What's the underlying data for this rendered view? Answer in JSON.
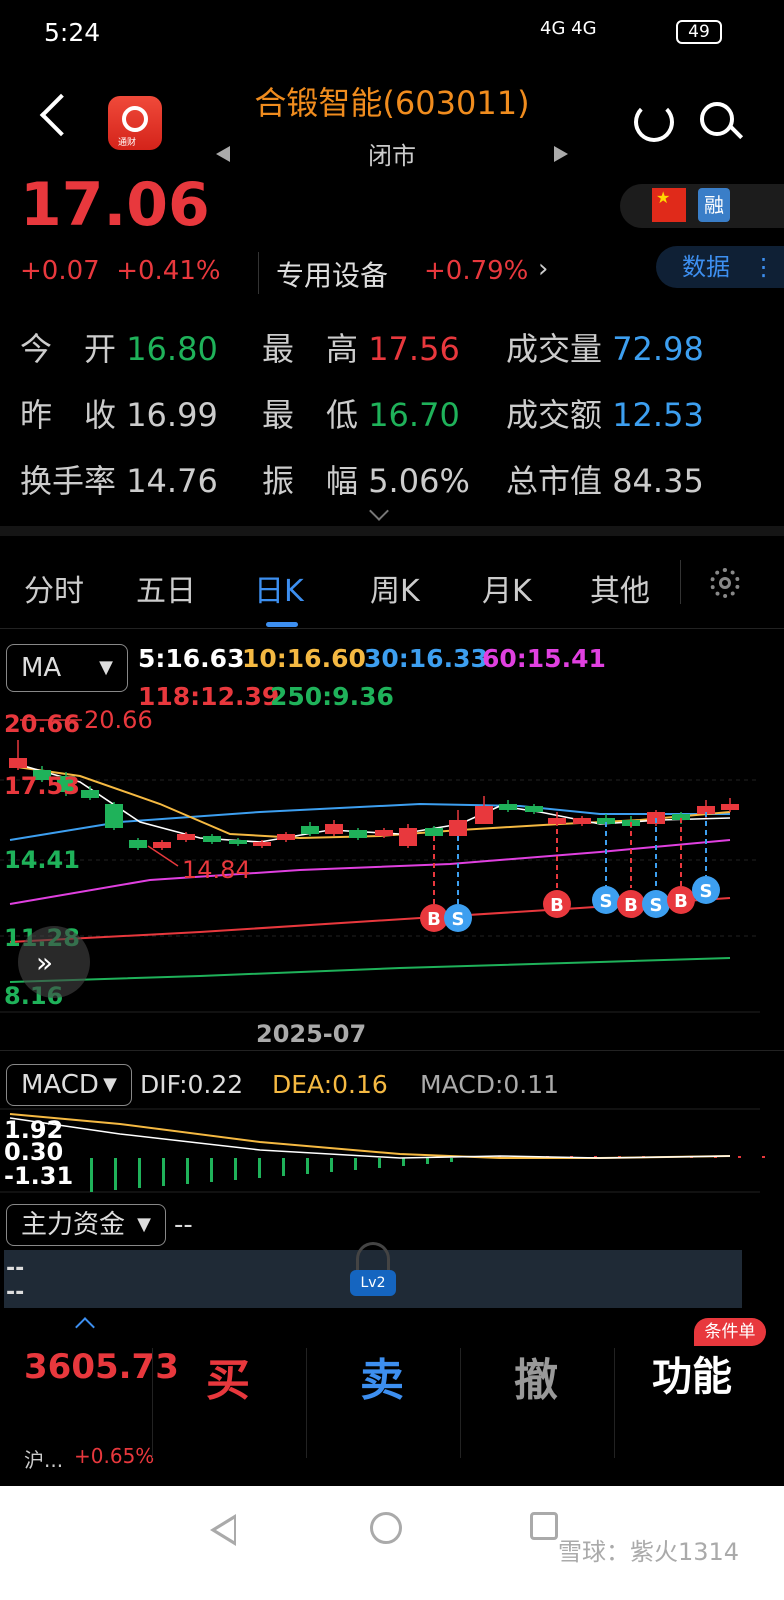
{
  "status_bar": {
    "time": "5:24",
    "network": "4G 4G",
    "battery": "49"
  },
  "header": {
    "title": "合锻智能(603011)",
    "market_status": "闭市",
    "app_icon_text": "通财"
  },
  "quote": {
    "price": "17.06",
    "change": "+0.07",
    "change_pct": "+0.41%",
    "industry": "专用设备",
    "industry_change": "+0.79%",
    "flags": {
      "rong": "融"
    },
    "data_button": "数据",
    "rows": [
      [
        {
          "label": "今　开",
          "value": "16.80"
        },
        {
          "label": "最　高",
          "value": "17.56"
        },
        {
          "label": "成交量",
          "value": "72.98"
        }
      ],
      [
        {
          "label": "昨　收",
          "value": "16.99"
        },
        {
          "label": "最　低",
          "value": "16.70"
        },
        {
          "label": "成交额",
          "value": "12.53"
        }
      ],
      [
        {
          "label": "换手率",
          "value": "14.76"
        },
        {
          "label": "振　幅",
          "value": "5.06%"
        },
        {
          "label": "总市值",
          "value": "84.35"
        }
      ]
    ],
    "colors": {
      "up": "#e8383d",
      "down": "#1fb25a",
      "volume": "#3d9ff0"
    }
  },
  "tabs": [
    "分时",
    "五日",
    "日K",
    "周K",
    "月K",
    "其他"
  ],
  "active_tab": "日K",
  "kline": {
    "indicator": "MA",
    "ma": [
      {
        "label": "5:16.63",
        "color": "#ffffff"
      },
      {
        "label": "10:16.60",
        "color": "#f5b942"
      },
      {
        "label": "30:16.33",
        "color": "#3d9ff0"
      },
      {
        "label": "60:15.41",
        "color": "#e040e0"
      },
      {
        "label": "118:12.39",
        "color": "#e8383d"
      },
      {
        "label": "250:9.36",
        "color": "#1fb25a"
      }
    ],
    "y_labels": [
      "20.66",
      "17.53",
      "14.41",
      "11.28",
      "8.16"
    ],
    "high_marker": "20.66",
    "low_marker": "14.84",
    "date_label": "2025-07",
    "signals": [
      "B",
      "S",
      "B",
      "S",
      "B",
      "S",
      "B",
      "S"
    ]
  },
  "macd": {
    "indicator": "MACD",
    "dif": "DIF:0.22",
    "dea": "DEA:0.16",
    "macd": "MACD:0.11",
    "y_labels": [
      "1.92",
      "0.30",
      "-1.31"
    ]
  },
  "main_force": {
    "indicator": "主力资金",
    "value": "--",
    "rows": [
      "--",
      "--"
    ],
    "lv2": "Lv2"
  },
  "bottom": {
    "index_value": "3605.73",
    "index_name": "沪...",
    "index_change": "+0.65%",
    "buy": "买",
    "sell": "卖",
    "cancel": "撤",
    "more": "功能",
    "badge": "条件单"
  },
  "watermark": "雪球：紫火1314"
}
